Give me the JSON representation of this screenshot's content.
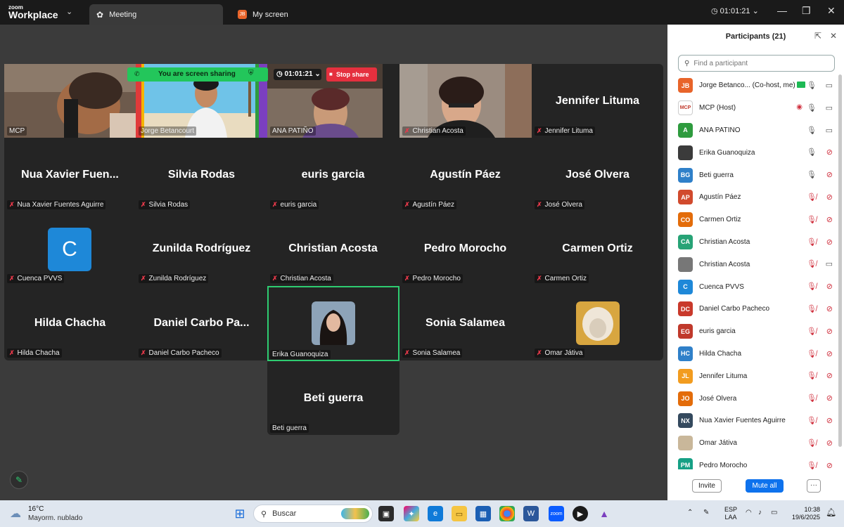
{
  "app": {
    "brand_top": "zoom",
    "brand_bottom": "Workplace"
  },
  "tabs": [
    {
      "label": "Meeting",
      "active": true
    },
    {
      "label": "My screen",
      "badge": "JB",
      "active": false
    }
  ],
  "meeting_timer": "01:01:21",
  "share_bar": {
    "message": "You are screen sharing",
    "timer": "01:01:21",
    "stop_label": "Stop share"
  },
  "tiles": [
    {
      "label": "MCP",
      "type": "video"
    },
    {
      "label": "Jorge Betancourt",
      "type": "video"
    },
    {
      "label": "ANA PATIÑO",
      "type": "video"
    },
    {
      "label": "Christian Acosta",
      "type": "video",
      "muted": true
    },
    {
      "name": "Jennifer Lituma",
      "label": "Jennifer Lituma",
      "muted": true
    },
    {
      "name": "Nua  Xavier  Fuen...",
      "label": "Nua Xavier Fuentes Aguirre",
      "muted": true
    },
    {
      "name": "Silvia Rodas",
      "label": "Silvia Rodas",
      "muted": true
    },
    {
      "name": "euris garcia",
      "label": "euris garcia",
      "muted": true
    },
    {
      "name": "Agustín Páez",
      "label": "Agustín Páez",
      "muted": true
    },
    {
      "name": "José Olvera",
      "label": "José Olvera",
      "muted": true
    },
    {
      "avatar_letter": "C",
      "label": "Cuenca PVVS",
      "muted": true
    },
    {
      "name": "Zunilda Rodríguez",
      "label": "Zunilda Rodríguez",
      "muted": true
    },
    {
      "name": "Christian Acosta",
      "label": "Christian Acosta",
      "muted": true
    },
    {
      "name": "Pedro Morocho",
      "label": "Pedro Morocho",
      "muted": true
    },
    {
      "name": "Carmen Ortiz",
      "label": "Carmen Ortiz",
      "muted": true
    },
    {
      "name": "Hilda Chacha",
      "label": "Hilda Chacha",
      "muted": true
    },
    {
      "name": "Daniel  Carbo  Pa...",
      "label": "Daniel Carbo Pacheco",
      "muted": true
    },
    {
      "avatar_photo": true,
      "label": "Erika Guanoquiza",
      "selected": true
    },
    {
      "name": "Sonia Salamea",
      "label": "Sonia Salamea",
      "muted": true
    },
    {
      "avatar_photo": true,
      "label": "Omar Játiva",
      "muted": true
    },
    {
      "name": "Beti guerra",
      "label": "Beti guerra"
    }
  ],
  "participants_panel": {
    "title": "Participants (21)",
    "search_placeholder": "Find a participant",
    "invite_label": "Invite",
    "mute_all_label": "Mute all",
    "more_label": "···",
    "participants": [
      {
        "initials": "JB",
        "color": "#e8642a",
        "name": "Jorge Betanco...  (Co-host, me)",
        "mic": "on",
        "cam": "on",
        "sharing": true
      },
      {
        "initials": "MCP",
        "color": "#ffffff",
        "name": "MCP (Host)",
        "mic": "on",
        "cam": "on",
        "recording": true,
        "logo": true
      },
      {
        "initials": "A",
        "color": "#2e9b3e",
        "name": "ANA PATIÑO",
        "mic": "on",
        "cam": "on"
      },
      {
        "initials": "",
        "color": "#3b3b3b",
        "name": "Erika Guanoquiza",
        "mic": "on",
        "cam": "off",
        "photo": true
      },
      {
        "initials": "BG",
        "color": "#2f80c9",
        "name": "Beti guerra",
        "mic": "on",
        "cam": "off"
      },
      {
        "initials": "AP",
        "color": "#d14a2d",
        "name": "Agustín Páez",
        "mic": "off",
        "cam": "off"
      },
      {
        "initials": "CO",
        "color": "#e36c0a",
        "name": "Carmen Ortiz",
        "mic": "off",
        "cam": "off"
      },
      {
        "initials": "CA",
        "color": "#27a376",
        "name": "Christian Acosta",
        "mic": "off",
        "cam": "off"
      },
      {
        "initials": "",
        "color": "#777777",
        "name": "Christian Acosta",
        "mic": "off",
        "cam": "on",
        "photo": true
      },
      {
        "initials": "C",
        "color": "#1e88d8",
        "name": "Cuenca PVVS",
        "mic": "off",
        "cam": "off"
      },
      {
        "initials": "DC",
        "color": "#c9392b",
        "name": "Daniel Carbo Pacheco",
        "mic": "off",
        "cam": "off"
      },
      {
        "initials": "EG",
        "color": "#c0392b",
        "name": "euris garcia",
        "mic": "off",
        "cam": "off"
      },
      {
        "initials": "HC",
        "color": "#2f80c9",
        "name": "Hilda Chacha",
        "mic": "off",
        "cam": "off"
      },
      {
        "initials": "JL",
        "color": "#f29c1f",
        "name": "Jennifer Lituma",
        "mic": "off",
        "cam": "off"
      },
      {
        "initials": "JO",
        "color": "#e36c0a",
        "name": "José Olvera",
        "mic": "off",
        "cam": "off"
      },
      {
        "initials": "NX",
        "color": "#34495e",
        "name": "Nua Xavier Fuentes Aguirre",
        "mic": "off",
        "cam": "off"
      },
      {
        "initials": "",
        "color": "#c9b79a",
        "name": "Omar Játiva",
        "mic": "off",
        "cam": "off",
        "photo": true
      },
      {
        "initials": "PM",
        "color": "#16a085",
        "name": "Pedro Morocho",
        "mic": "off",
        "cam": "off"
      }
    ]
  },
  "taskbar": {
    "temperature": "16°C",
    "condition": "Mayorm. nublado",
    "search_label": "Buscar",
    "lang_top": "ESP",
    "lang_bottom": "LAA",
    "time": "10:38",
    "date": "19/6/2025"
  }
}
